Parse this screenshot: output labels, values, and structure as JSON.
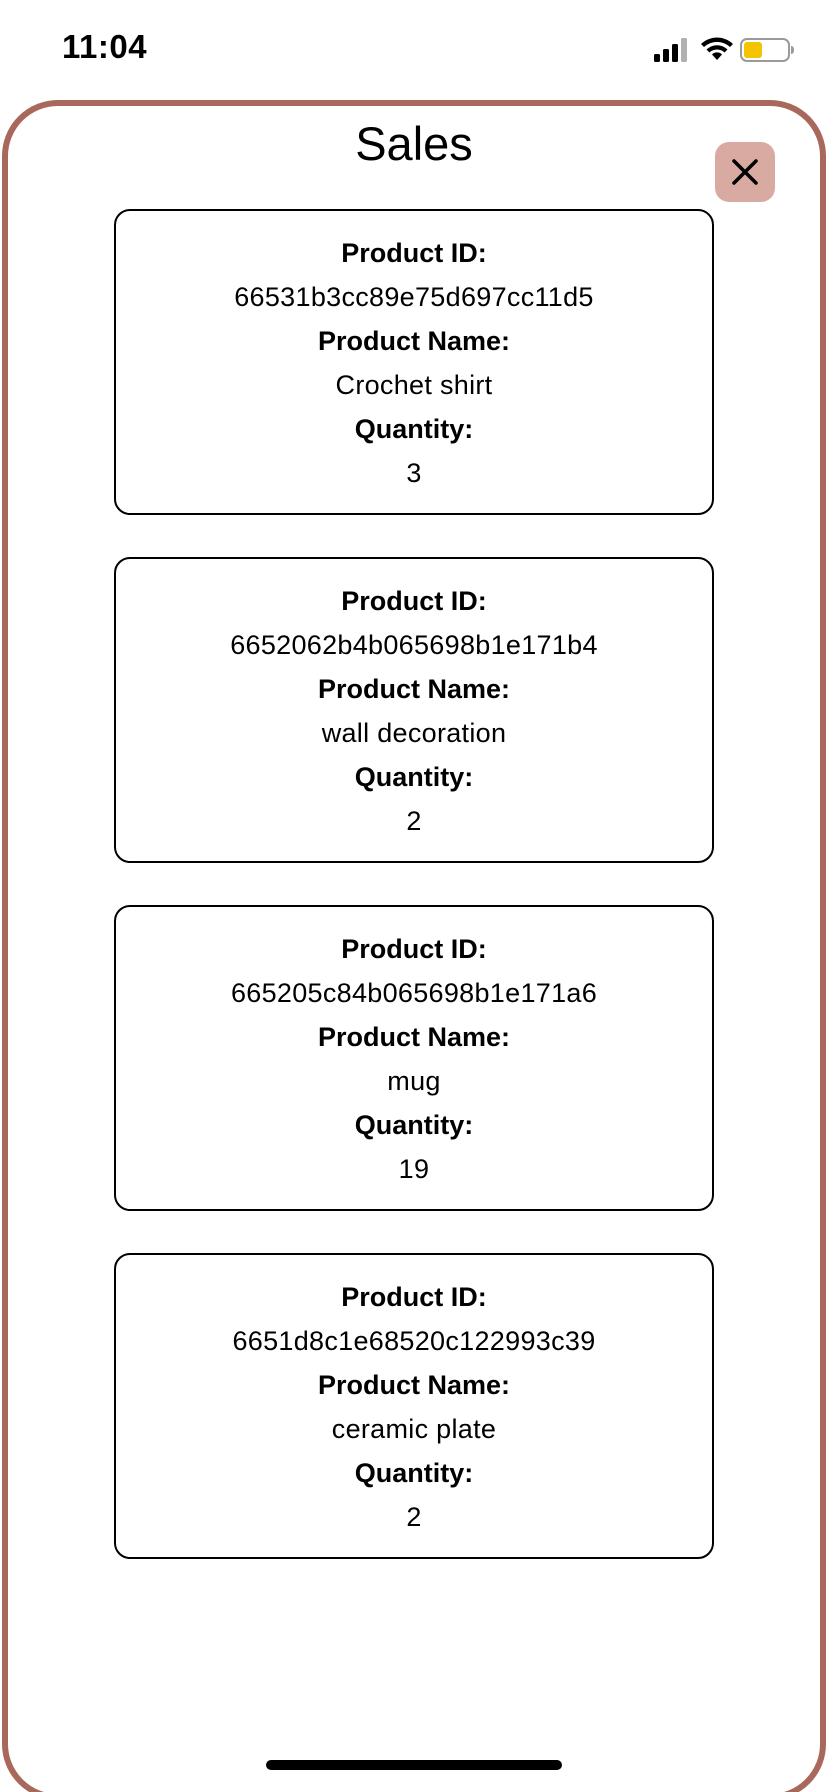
{
  "status_bar": {
    "time": "11:04",
    "icons": [
      "signal-icon",
      "wifi-icon",
      "battery-icon"
    ],
    "battery_color": "#f5c400"
  },
  "modal": {
    "title": "Sales",
    "border_color": "#a8685c",
    "close_button_color": "#d8aaa2",
    "close_icon": "close-icon"
  },
  "labels": {
    "product_id": "Product ID:",
    "product_name": "Product Name:",
    "quantity": "Quantity:"
  },
  "sales": [
    {
      "product_id": "66531b3cc89e75d697cc11d5",
      "product_name": "Crochet shirt",
      "quantity": "3"
    },
    {
      "product_id": "6652062b4b065698b1e171b4",
      "product_name": "wall decoration",
      "quantity": "2"
    },
    {
      "product_id": "665205c84b065698b1e171a6",
      "product_name": "mug",
      "quantity": "19"
    },
    {
      "product_id": "6651d8c1e68520c122993c39",
      "product_name": "ceramic plate",
      "quantity": "2"
    }
  ]
}
